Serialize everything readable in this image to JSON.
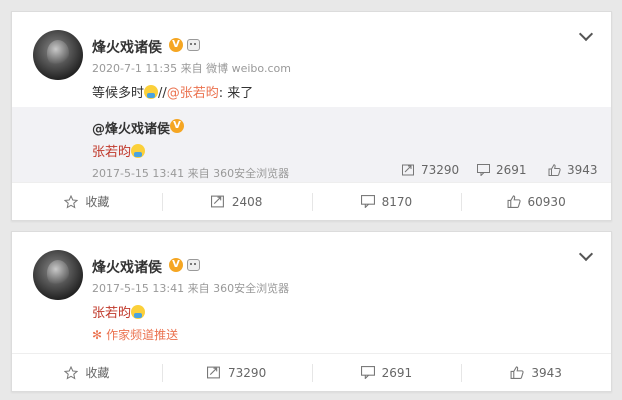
{
  "card1": {
    "username": "烽火戏诸侯",
    "meta": "2020-7-1 11:35 来自 微博 weibo.com",
    "text_prefix": "等候多时",
    "text_sep": "//",
    "text_mention": "@张若昀",
    "text_suffix": ": 来了",
    "quote": {
      "username": "@烽火戏诸侯",
      "text": "张若昀",
      "meta": "2017-5-15 13:41 来自 360安全浏览器",
      "reposts": "73290",
      "comments": "2691",
      "likes": "3943"
    },
    "actions": {
      "favorite": "收藏",
      "repost": "2408",
      "comment": "8170",
      "like": "60930"
    }
  },
  "card2": {
    "username": "烽火戏诸侯",
    "meta": "2017-5-15 13:41 来自 360安全浏览器",
    "text": "张若昀",
    "recommend": "作家频道推送",
    "actions": {
      "favorite": "收藏",
      "repost": "73290",
      "comment": "2691",
      "like": "3943"
    }
  },
  "icons": {
    "verified": "V",
    "chevron": "chevron-down-icon"
  },
  "colors": {
    "mention": "#eb7350",
    "verified": "#f5a623",
    "quote_bg": "#f2f2f5"
  }
}
